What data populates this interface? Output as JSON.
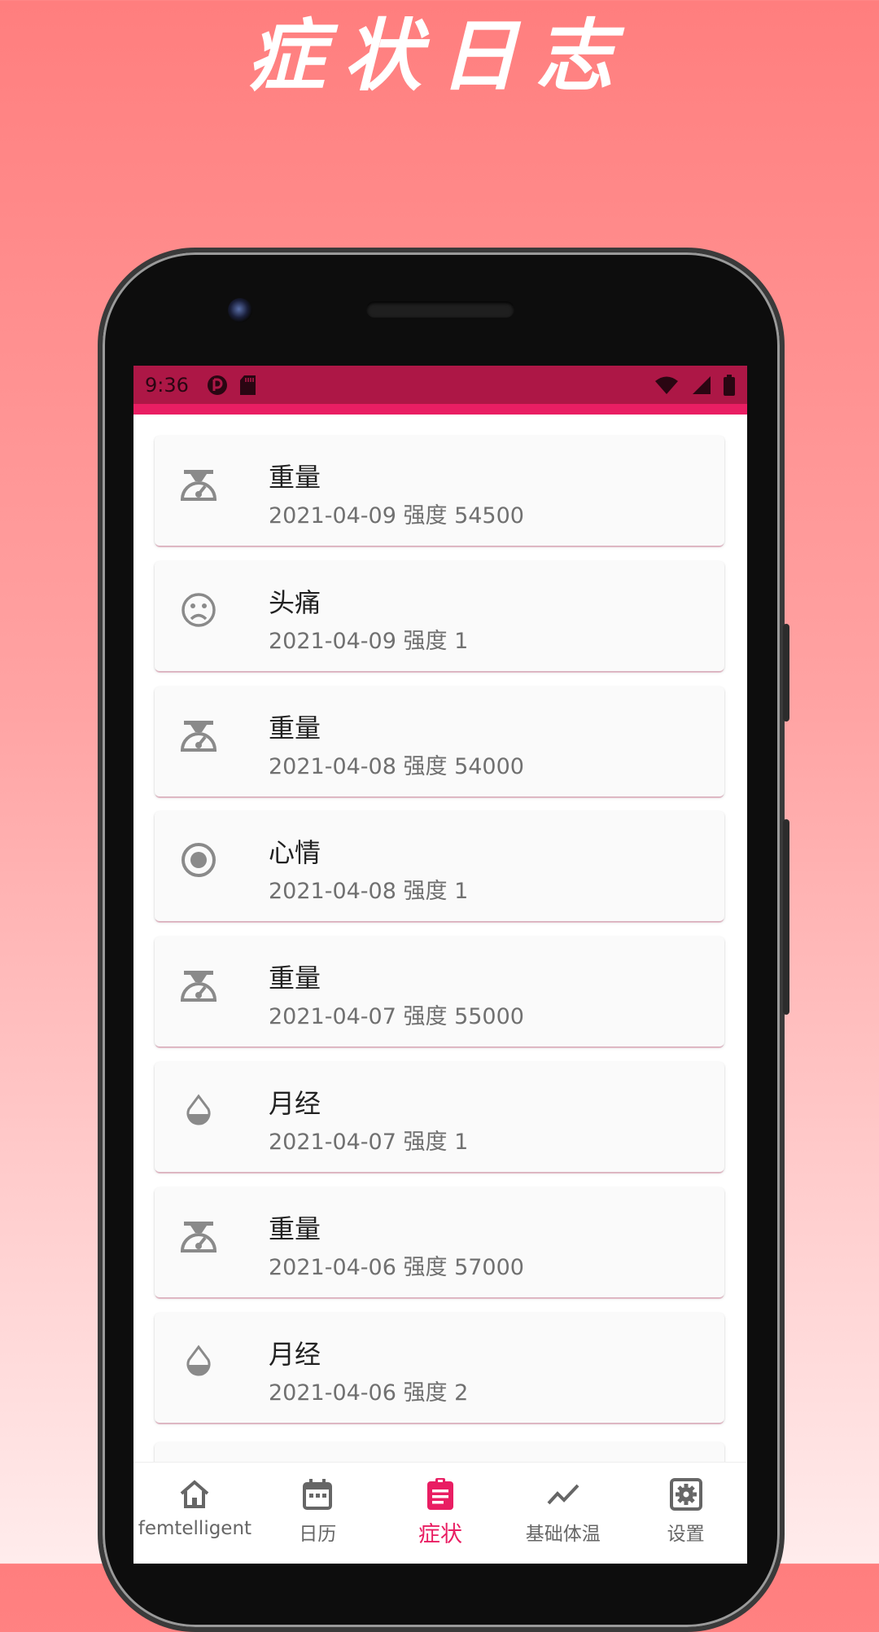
{
  "promo": {
    "title": "症状日志"
  },
  "status_bar": {
    "time": "9:36"
  },
  "symptoms": [
    {
      "icon": "scale-icon",
      "title": "重量",
      "subtitle": "2021-04-09 强度 54500"
    },
    {
      "icon": "sad-face-icon",
      "title": "头痛",
      "subtitle": "2021-04-09 强度 1"
    },
    {
      "icon": "scale-icon",
      "title": "重量",
      "subtitle": "2021-04-08 强度 54000"
    },
    {
      "icon": "radio-circle-icon",
      "title": "心情",
      "subtitle": "2021-04-08 强度 1"
    },
    {
      "icon": "scale-icon",
      "title": "重量",
      "subtitle": "2021-04-07 强度 55000"
    },
    {
      "icon": "drop-icon",
      "title": "月经",
      "subtitle": "2021-04-07 强度 1"
    },
    {
      "icon": "scale-icon",
      "title": "重量",
      "subtitle": "2021-04-06 强度 57000"
    },
    {
      "icon": "drop-icon",
      "title": "月经",
      "subtitle": "2021-04-06 强度 2"
    }
  ],
  "bottom_nav": [
    {
      "icon": "home-icon",
      "label": "femtelligent"
    },
    {
      "icon": "calendar-icon",
      "label": "日历"
    },
    {
      "icon": "clipboard-icon",
      "label": "症状",
      "active": true
    },
    {
      "icon": "trend-line-icon",
      "label": "基础体温"
    },
    {
      "icon": "settings-icon",
      "label": "设置"
    }
  ],
  "colors": {
    "accent": "#e91e63",
    "status_bar": "#ad1746",
    "icon_gray": "#8a8a8a",
    "nav_gray": "#666666"
  }
}
